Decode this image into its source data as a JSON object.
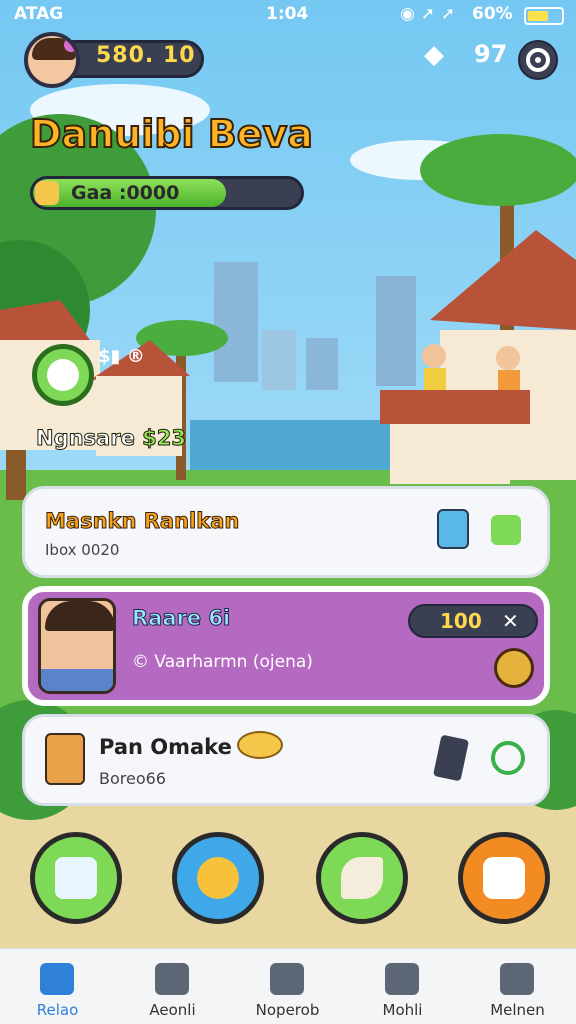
{
  "statusbar": {
    "carrier": "ATAG",
    "time": "1:04",
    "icons": "◉ ➚ ➚",
    "battery": "60%"
  },
  "player": {
    "currency": "580. 10"
  },
  "top_right": {
    "cube": "◆",
    "number": "97"
  },
  "title": "Danuibi Beva",
  "progress": {
    "label": "Gaa :0000",
    "fill_fraction": 0.72
  },
  "orb_side_text": "$▮ ®",
  "bonus": {
    "label": "Ngnsare",
    "amount": "$23"
  },
  "cards": [
    {
      "title": "Masnkn Ranlkan",
      "subtitle": "Ibox 0020"
    },
    {
      "title": "Raare 6i",
      "subtitle": "© Vaarharmn (ojena)",
      "pill_value": "100",
      "pill_icon": "✕"
    },
    {
      "title": "Pan Omake",
      "subtitle": "Boreo66"
    }
  ],
  "big_buttons": [
    {
      "name": "chart-button"
    },
    {
      "name": "character-button"
    },
    {
      "name": "bone-button"
    },
    {
      "name": "dice-button"
    }
  ],
  "tabs": [
    {
      "label": "Relao"
    },
    {
      "label": "Aeonli"
    },
    {
      "label": "Noperob"
    },
    {
      "label": "Mohli"
    },
    {
      "label": "Melnen"
    }
  ],
  "colors": {
    "sky": "#8fd3f4",
    "accent_orange": "#ffb327",
    "progress_green": "#4bb32a",
    "card_purple": "#b56ac2",
    "tab_active": "#2f80d8"
  }
}
